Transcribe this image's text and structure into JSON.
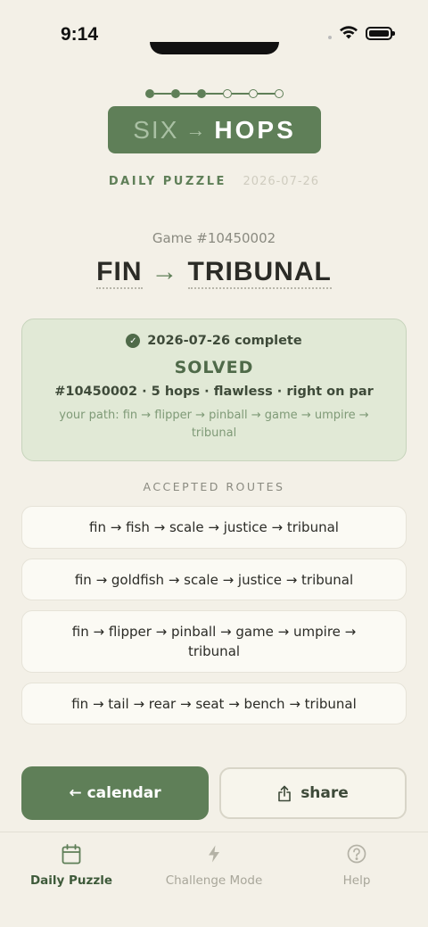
{
  "status_bar": {
    "time": "9:14"
  },
  "progress": {
    "total_steps": 6,
    "filled_steps": 3
  },
  "logo": {
    "left": "SIX",
    "arrow": "→",
    "right": "HOPS"
  },
  "daily": {
    "label": "DAILY PUZZLE",
    "date": "2026-07-26"
  },
  "game": {
    "number": "Game #10450002"
  },
  "puzzle": {
    "start": "FIN",
    "arrow": "→",
    "end": "TRIBUNAL"
  },
  "result": {
    "complete": "2026-07-26 complete",
    "status": "SOLVED",
    "stats": "#10450002 · 5 hops · flawless · right on par",
    "path": "your path: fin → flipper → pinball → game → umpire → tribunal"
  },
  "routes": {
    "heading": "ACCEPTED ROUTES",
    "items": [
      "fin → fish → scale → justice → tribunal",
      "fin → goldfish → scale → justice → tribunal",
      "fin → flipper → pinball → game → umpire → tribunal",
      "fin → tail → rear → seat → bench → tribunal"
    ]
  },
  "buttons": {
    "calendar": "calendar",
    "calendar_arrow": "←",
    "share": "share"
  },
  "tabs": [
    {
      "label": "Daily Puzzle",
      "icon": "calendar-icon",
      "active": true
    },
    {
      "label": "Challenge Mode",
      "icon": "lightning-icon",
      "active": false
    },
    {
      "label": "Help",
      "icon": "help-icon",
      "active": false
    }
  ],
  "colors": {
    "accent": "#5f7f58",
    "background": "#f3f0e7",
    "success_bg": "#e1e9d6"
  }
}
